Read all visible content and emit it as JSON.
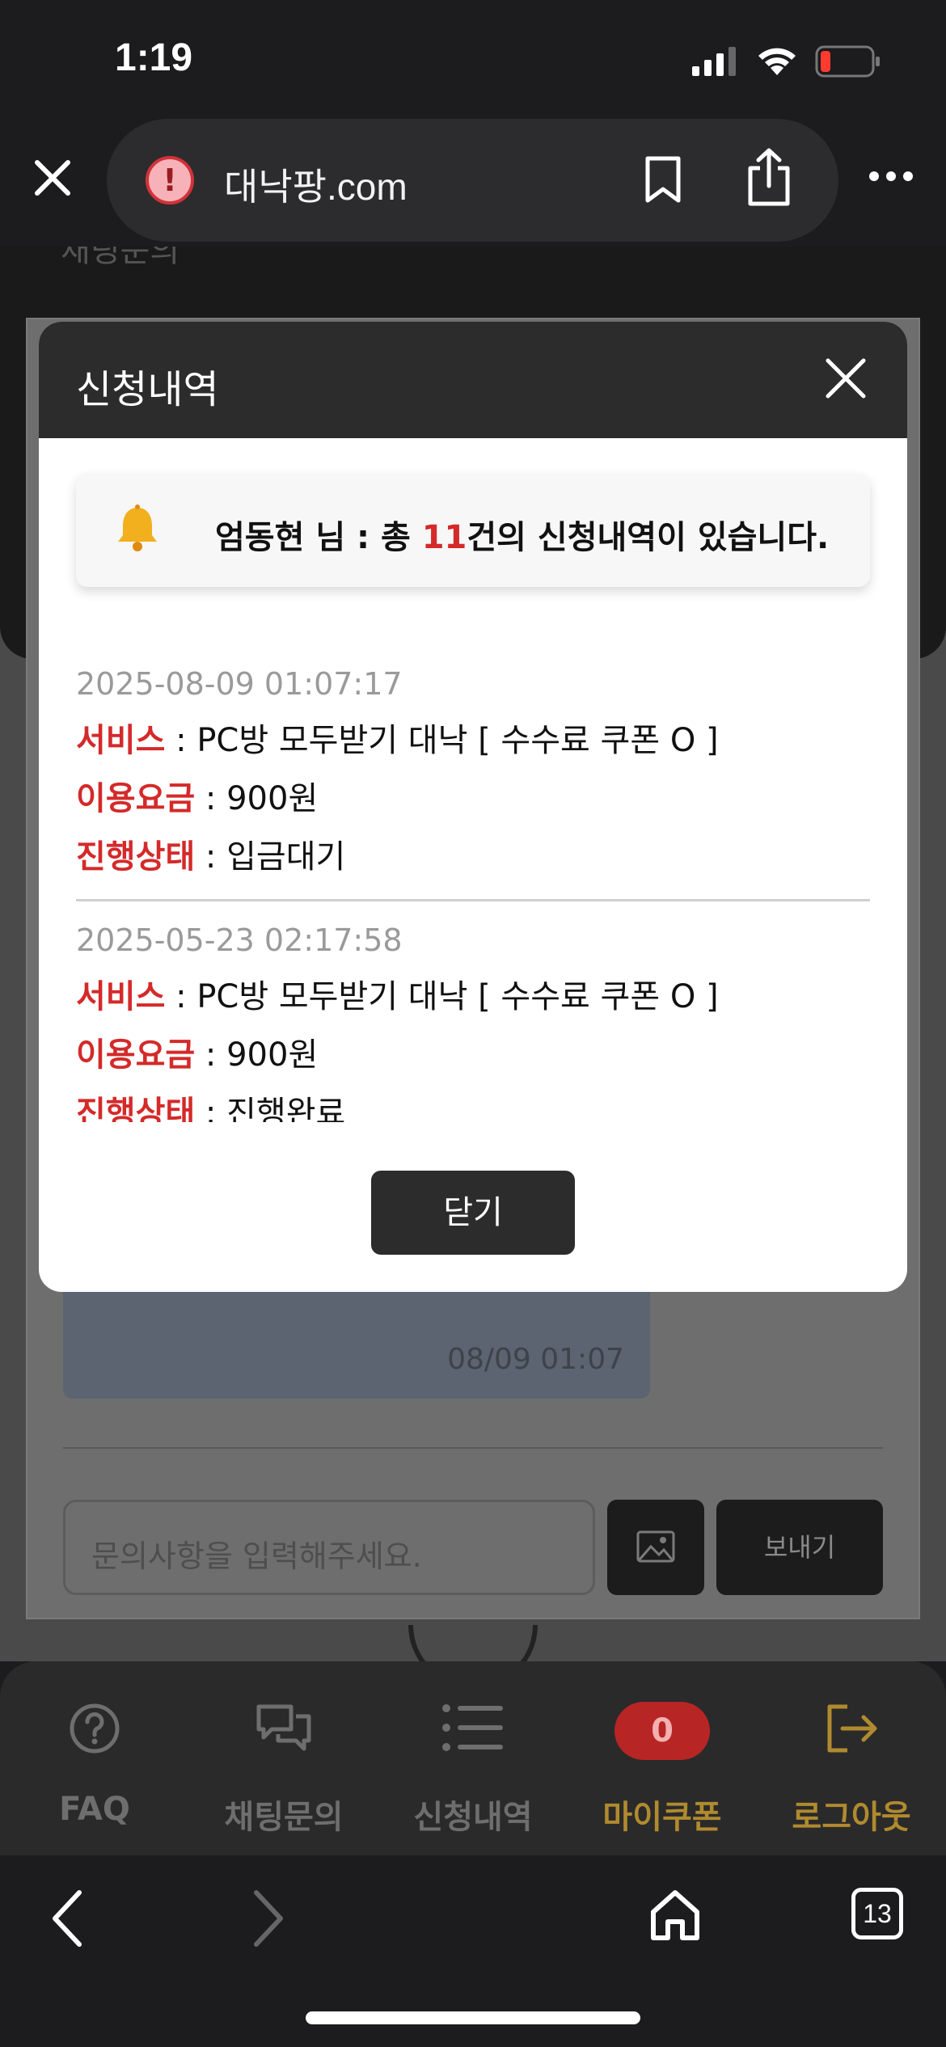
{
  "status_bar": {
    "time": "1:19"
  },
  "browser": {
    "url": "대낙팡.com",
    "tab_count": "13"
  },
  "background_page": {
    "header_text": "채팅문의",
    "message_time": "08/09 01:07",
    "input_placeholder": "문의사항을 입력해주세요.",
    "send_label": "보내기"
  },
  "modal": {
    "title": "신청내역",
    "notice": {
      "prefix": "엄동현 님 : 총 ",
      "count": "11",
      "suffix": "건의 신청내역이 있습니다."
    },
    "entries": [
      {
        "date": "2025-08-09 01:07:17",
        "service_key": "서비스",
        "service_value": " : PC방 모두받기 대낙 [ 수수료 쿠폰 O ]",
        "fee_key": "이용요금",
        "fee_value": " : 900원",
        "status_key": "진행상태",
        "status_value": " : 입금대기"
      },
      {
        "date": "2025-05-23 02:17:58",
        "service_key": "서비스",
        "service_value": " : PC방 모두받기 대낙 [ 수수료 쿠폰 O ]",
        "fee_key": "이용요금",
        "fee_value": " : 900원",
        "status_key": "진행상태",
        "status_value": " : 진행완료"
      }
    ],
    "close_label": "닫기"
  },
  "bottom_nav": {
    "items": [
      {
        "label": "FAQ",
        "icon": "question-circle-icon"
      },
      {
        "label": "채팅문의",
        "icon": "chat-bubbles-icon"
      },
      {
        "label": "신청내역",
        "icon": "list-icon"
      },
      {
        "label": "마이쿠폰",
        "badge": "0"
      },
      {
        "label": "로그아웃",
        "icon": "logout-icon"
      }
    ]
  },
  "colors": {
    "accent_red": "#d42a2a",
    "nav_gold": "#b08a2e",
    "header_dark": "#2c2c2c"
  }
}
